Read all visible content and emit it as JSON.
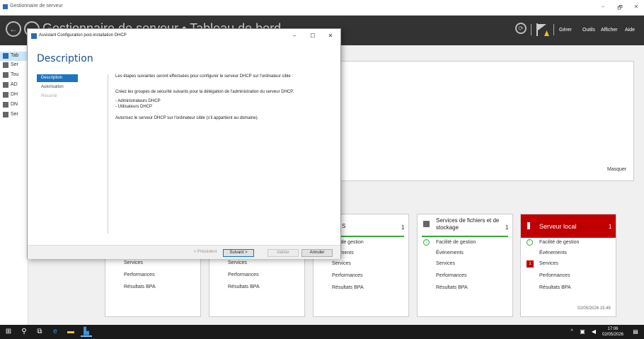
{
  "window": {
    "title": "Gestionnaire de serveur",
    "minimize": "–",
    "maximize": "🗗",
    "close": "✕"
  },
  "header": {
    "title": "Gestionnaire de serveur • Tableau de bord",
    "menu": [
      "Gérer",
      "Outils",
      "Afficher",
      "Aide"
    ],
    "back": "←",
    "forward": "→",
    "refresh": "⟳"
  },
  "sidebar": {
    "items": [
      {
        "label": "Tab",
        "icon": "dashboard-icon"
      },
      {
        "label": "Ser",
        "icon": "server-icon"
      },
      {
        "label": "Tou",
        "icon": "servers-icon"
      },
      {
        "label": "AD",
        "icon": "ad-icon"
      },
      {
        "label": "DH",
        "icon": "dhcp-icon"
      },
      {
        "label": "DN",
        "icon": "dns-icon"
      },
      {
        "label": "Ser",
        "icon": "file-services-icon"
      }
    ]
  },
  "welcome": {
    "hide_label": "Masquer"
  },
  "tiles": [
    {
      "title": "",
      "count": "",
      "rows": [
        "Services",
        "Performances",
        "Résultats BPA"
      ]
    },
    {
      "title": "",
      "count": "",
      "rows": [
        "Services",
        "Performances",
        "Résultats BPA"
      ]
    },
    {
      "title": "S",
      "count": "1",
      "rows": [
        "ilité de gestion",
        "énements",
        "Services",
        "Performances",
        "Résultats BPA"
      ]
    },
    {
      "title": "Services de fichiers et de stockage",
      "count": "1",
      "rows": [
        "Facilité de gestion",
        "Événements",
        "Services",
        "Performances",
        "Résultats BPA"
      ]
    },
    {
      "title": "Serveur local",
      "count": "1",
      "rows": [
        "Facilité de gestion",
        "Événements",
        "Services",
        "Performances",
        "Résultats BPA"
      ],
      "timestamp": "02/05/2026 15:49",
      "services_badge": "1"
    }
  ],
  "dialog": {
    "title": "Assistant Configuration post-installation DHCP",
    "heading": "Description",
    "steps": [
      {
        "label": "Description",
        "state": "active"
      },
      {
        "label": "Autorisation",
        "state": "normal"
      },
      {
        "label": "Résumé",
        "state": "disabled"
      }
    ],
    "body": {
      "line1": "Les étapes suivantes seront effectuées pour configurer le serveur DHCP sur l'ordinateur cible :",
      "line2": "Créez les groupes de sécurité suivants pour la délégation de l'administration du serveur DHCP.",
      "line3": "- Administrateurs DHCP",
      "line4": "- Utilisateurs DHCP",
      "line5": "Autorisez le serveur DHCP sur l'ordinateur cible (s'il appartient au domaine)."
    },
    "buttons": {
      "previous": "< Précédent",
      "next": "Suivant >",
      "validate": "Valider",
      "cancel": "Annuler"
    }
  },
  "taskbar": {
    "time": "17:06",
    "date": "02/05/2026"
  }
}
